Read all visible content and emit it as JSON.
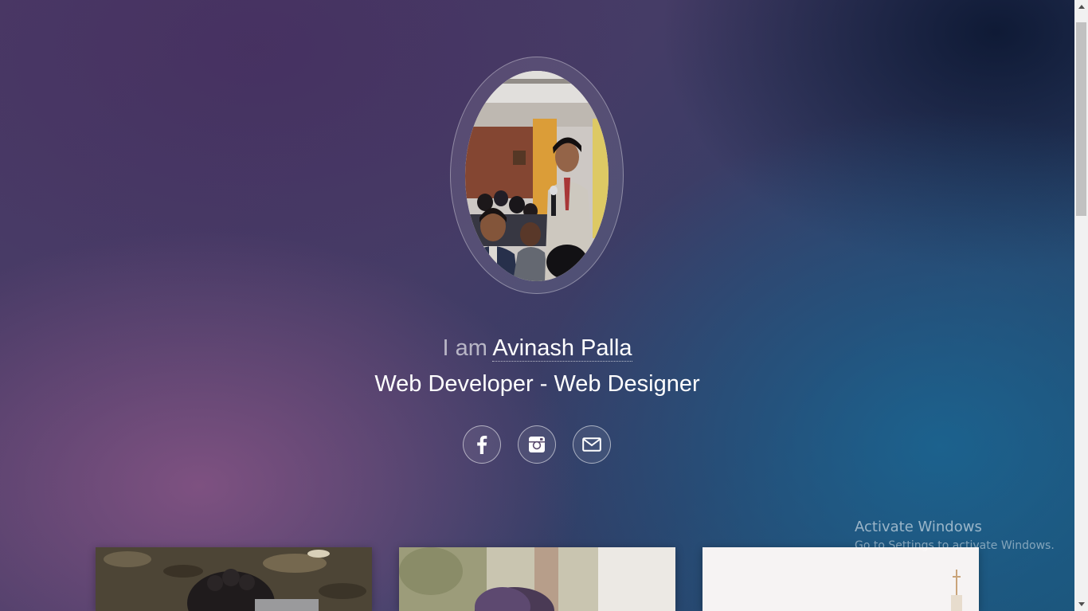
{
  "profile": {
    "intro_prefix": "I am",
    "name": "Avinash Palla",
    "role": "Web Developer - Web Designer"
  },
  "social": {
    "items": [
      {
        "name": "facebook",
        "icon": "facebook-icon"
      },
      {
        "name": "instagram",
        "icon": "instagram-icon"
      },
      {
        "name": "email",
        "icon": "envelope-icon"
      }
    ]
  },
  "watermark": {
    "title": "Activate Windows",
    "subtitle": "Go to Settings to activate Windows."
  },
  "colors": {
    "text": "#ffffff",
    "background_purple": "#4a3a66",
    "background_blue": "#1c4e72",
    "scrollbar_track": "#f1f1f1",
    "scrollbar_thumb": "#c1c1c1"
  }
}
